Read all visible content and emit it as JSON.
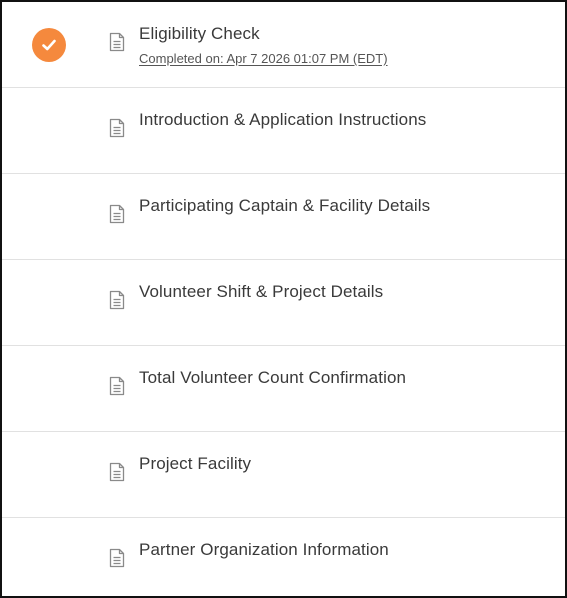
{
  "colors": {
    "check_bg": "#F5893D",
    "check_mark": "#ffffff",
    "doc_icon": "#8a8a8a"
  },
  "steps": [
    {
      "title": "Eligibility Check",
      "subtitle": "Completed on: Apr 7 2026 01:07 PM (EDT)",
      "completed": true,
      "icon": "document-icon",
      "status_icon": "check-circle-icon"
    },
    {
      "title": "Introduction & Application Instructions",
      "completed": false,
      "icon": "document-icon"
    },
    {
      "title": "Participating Captain & Facility Details",
      "completed": false,
      "icon": "document-icon"
    },
    {
      "title": "Volunteer Shift & Project Details",
      "completed": false,
      "icon": "document-icon"
    },
    {
      "title": "Total Volunteer Count Confirmation",
      "completed": false,
      "icon": "document-icon"
    },
    {
      "title": "Project Facility",
      "completed": false,
      "icon": "document-icon"
    },
    {
      "title": "Partner Organization Information",
      "completed": false,
      "icon": "document-icon"
    }
  ]
}
